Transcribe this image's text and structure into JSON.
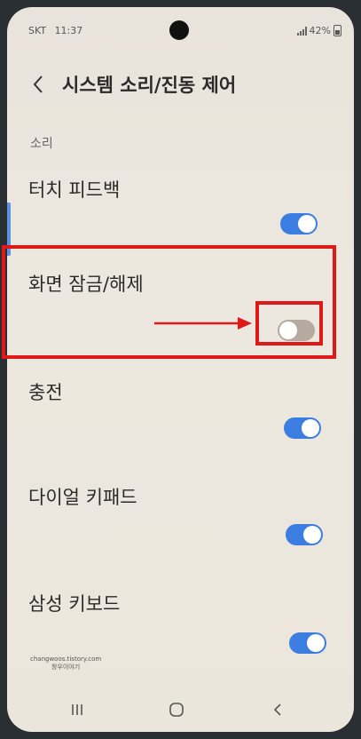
{
  "status_bar": {
    "carrier": "SKT",
    "time": "11:37",
    "battery": "42%"
  },
  "header": {
    "title": "시스템 소리/진동 제어"
  },
  "section_label": "소리",
  "items": [
    {
      "label": "터치 피드백",
      "enabled": true
    },
    {
      "label": "화면 잠금/해제",
      "enabled": false
    },
    {
      "label": "충전",
      "enabled": true
    },
    {
      "label": "다이얼 키패드",
      "enabled": true
    },
    {
      "label": "삼성 키보드",
      "enabled": true
    }
  ],
  "watermark": {
    "line1": "changwoos.tistory.com",
    "line2": "창우이야기"
  },
  "colors": {
    "toggle_on": "#3b7de0",
    "toggle_off": "#b5aaa0",
    "highlight": "#e01818"
  }
}
